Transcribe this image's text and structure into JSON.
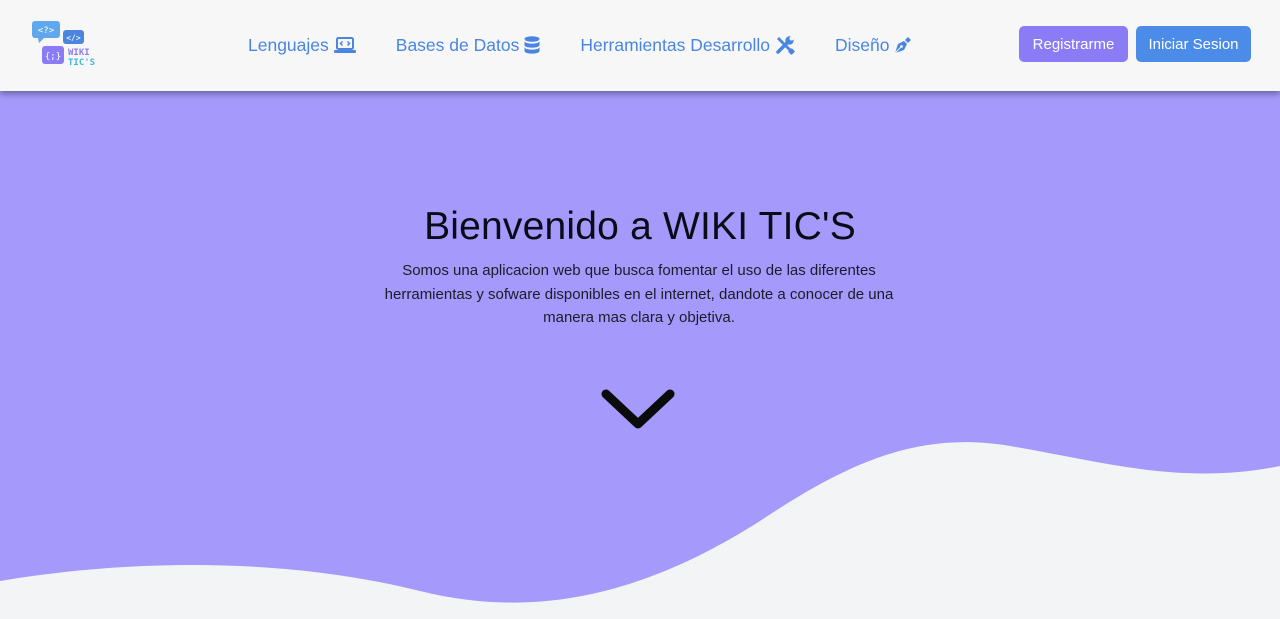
{
  "logo": {
    "bubble_1": "<?>",
    "bubble_2": "</>",
    "bubble_3": "{;}",
    "line_1": "WIKI",
    "line_2": "TIC'S"
  },
  "nav": {
    "items": [
      {
        "label": "Lenguajes",
        "icon": "laptop-code-icon"
      },
      {
        "label": "Bases de Datos",
        "icon": "database-icon"
      },
      {
        "label": "Herramientas Desarrollo",
        "icon": "tools-icon"
      },
      {
        "label": "Diseño",
        "icon": "pen-nib-icon"
      }
    ]
  },
  "buttons": {
    "register": "Registrarme",
    "login": "Iniciar Sesion"
  },
  "hero": {
    "title": "Bienvenido a WIKI TIC'S",
    "description": "Somos una aplicacion web que busca fomentar el uso de las diferentes herramientas y sofware disponibles en el internet, dandote a conocer de una manera mas clara y objetiva.",
    "scroll_icon": "chevron-down-icon"
  },
  "colors": {
    "nav_link": "#4a86e0",
    "register_button": "#8b7cf6",
    "login_button": "#4a8ce8",
    "hero_background": "#a599fb",
    "page_background": "#f3f4f6"
  }
}
